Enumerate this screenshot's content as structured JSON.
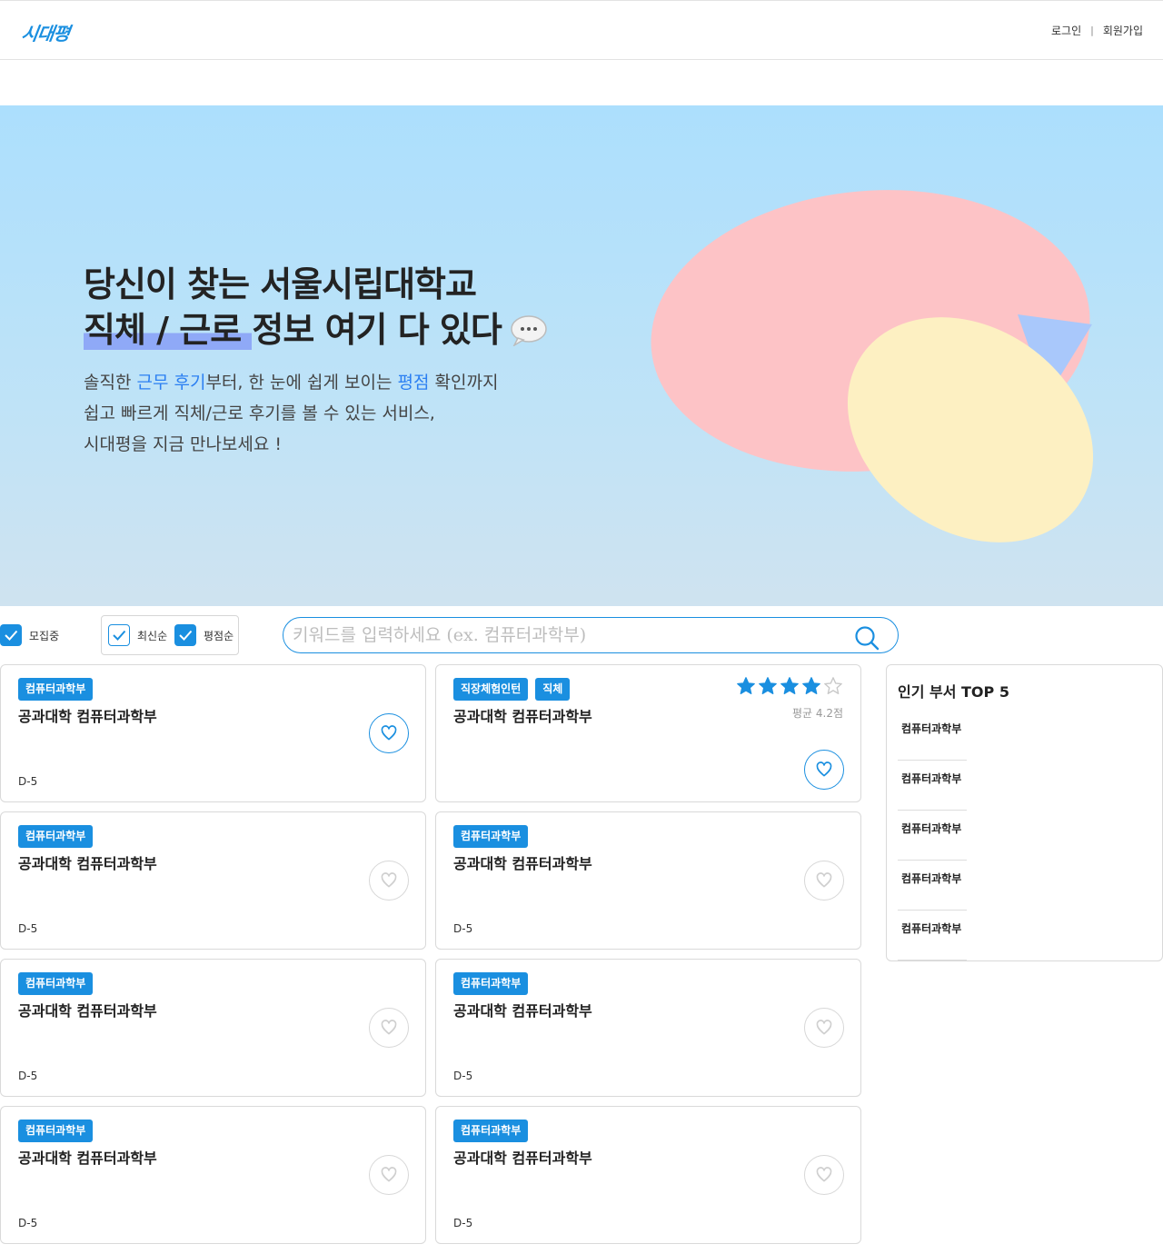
{
  "header": {
    "logo": "시대평",
    "login": "로그인",
    "separator": "|",
    "signup": "회원가입"
  },
  "hero": {
    "title_line1": "당신이 찾는 서울시립대학교",
    "title_line2_highlight": "직체 / 근로 ",
    "title_line2_rest": "정보 여기 다 있다",
    "desc_line1_a": "솔직한 ",
    "desc_line1_b": "근무 후기",
    "desc_line1_c": "부터, 한 눈에 쉽게 보이는 ",
    "desc_line1_d": "평점",
    "desc_line1_e": " 확인까지",
    "desc_line2": "쉽고 빠르게 직체/근로 후기를 볼 수 있는 서비스,",
    "desc_line3": "시대평을 지금 만나보세요 !"
  },
  "filters": {
    "recruiting": {
      "label": "모집중",
      "checked": true
    },
    "latest": {
      "label": "최신순",
      "checked": true
    },
    "rating": {
      "label": "평점순",
      "checked": true
    }
  },
  "search": {
    "value": "",
    "placeholder": "키워드를 입력하세요 (ex. 컴퓨터과학부)"
  },
  "cards": [
    {
      "tags": [
        "컴퓨터과학부"
      ],
      "title": "공과대학 컴퓨터과학부",
      "dday": "D-5",
      "liked": true
    },
    {
      "tags": [
        "직장체험인턴",
        "직체"
      ],
      "title": "공과대학 컴퓨터과학부",
      "dday": "",
      "liked": true,
      "rating": 4,
      "rating_max": 5,
      "avg_text": "평균 4.2점"
    },
    {
      "tags": [
        "컴퓨터과학부"
      ],
      "title": "공과대학 컴퓨터과학부",
      "dday": "D-5",
      "liked": false
    },
    {
      "tags": [
        "컴퓨터과학부"
      ],
      "title": "공과대학 컴퓨터과학부",
      "dday": "D-5",
      "liked": false
    },
    {
      "tags": [
        "컴퓨터과학부"
      ],
      "title": "공과대학 컴퓨터과학부",
      "dday": "D-5",
      "liked": false
    },
    {
      "tags": [
        "컴퓨터과학부"
      ],
      "title": "공과대학 컴퓨터과학부",
      "dday": "D-5",
      "liked": false
    },
    {
      "tags": [
        "컴퓨터과학부"
      ],
      "title": "공과대학 컴퓨터과학부",
      "dday": "D-5",
      "liked": false
    },
    {
      "tags": [
        "컴퓨터과학부"
      ],
      "title": "공과대학 컴퓨터과학부",
      "dday": "D-5",
      "liked": false
    }
  ],
  "popular": {
    "title": "인기 부서 TOP 5",
    "items": [
      "컴퓨터과학부",
      "컴퓨터과학부",
      "컴퓨터과학부",
      "컴퓨터과학부",
      "컴퓨터과학부"
    ]
  },
  "colors": {
    "accent": "#1a8fe0",
    "hero_bg": "#acdffd",
    "blob_pink": "#fdc3c6",
    "blob_yellow": "#fdf0c2",
    "blob_blue": "#a9c8fb",
    "highlight": "#8fa9f7"
  }
}
